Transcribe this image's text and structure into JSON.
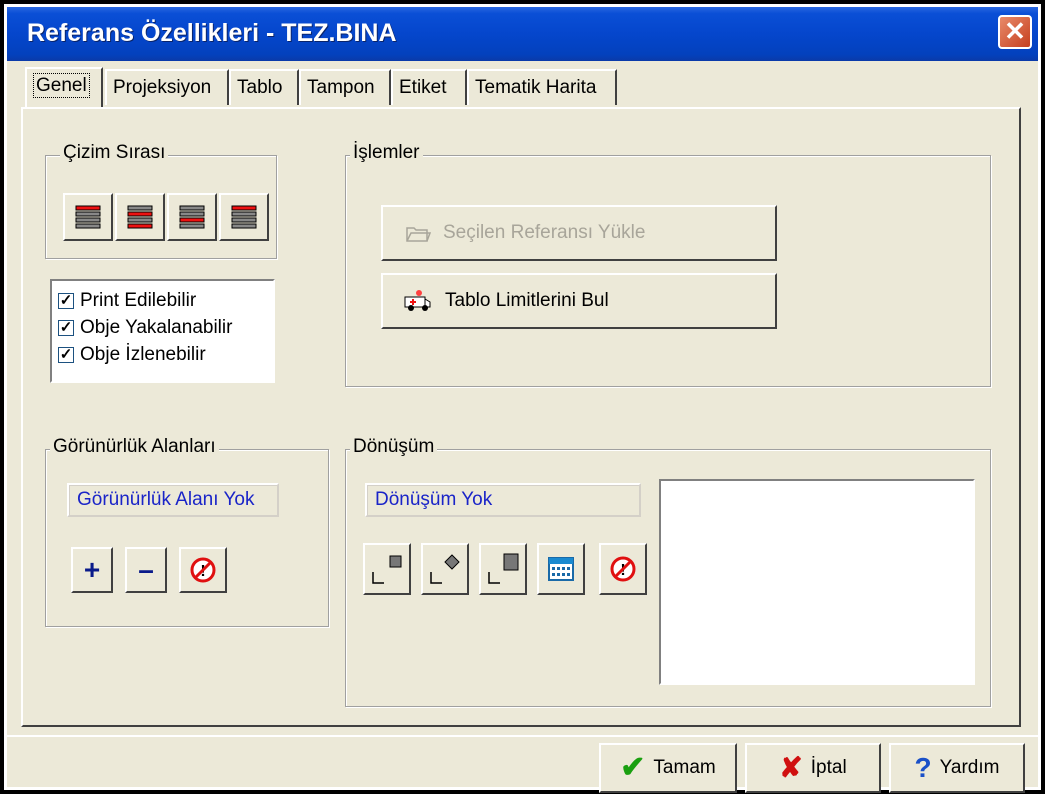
{
  "window": {
    "title": "Referans Özellikleri - TEZ.BINA",
    "close_icon": "close-icon"
  },
  "tabs": [
    {
      "label": "Genel",
      "active": true
    },
    {
      "label": "Projeksiyon"
    },
    {
      "label": "Tablo"
    },
    {
      "label": "Tampon"
    },
    {
      "label": "Etiket"
    },
    {
      "label": "Tematik Harita"
    }
  ],
  "cizim_sirasi": {
    "label": "Çizim Sırası"
  },
  "options": {
    "items": [
      {
        "label": "Print Edilebilir",
        "checked": true
      },
      {
        "label": "Obje Yakalanabilir",
        "checked": true
      },
      {
        "label": "Obje İzlenebilir",
        "checked": true
      }
    ]
  },
  "islemler": {
    "label": "İşlemler",
    "load_button": "Seçilen Referansı Yükle",
    "limits_button": "Tablo Limitlerini Bul"
  },
  "gorunurluk": {
    "label": "Görünürlük Alanları",
    "value": "Görünürlük Alanı Yok"
  },
  "donusum": {
    "label": "Dönüşüm",
    "value": "Dönüşüm Yok"
  },
  "footer": {
    "ok": "Tamam",
    "cancel": "İptal",
    "help": "Yardım"
  },
  "colors": {
    "title_bar": "#0546cc",
    "face": "#ECE9D8",
    "field_text": "#1a24c8"
  }
}
